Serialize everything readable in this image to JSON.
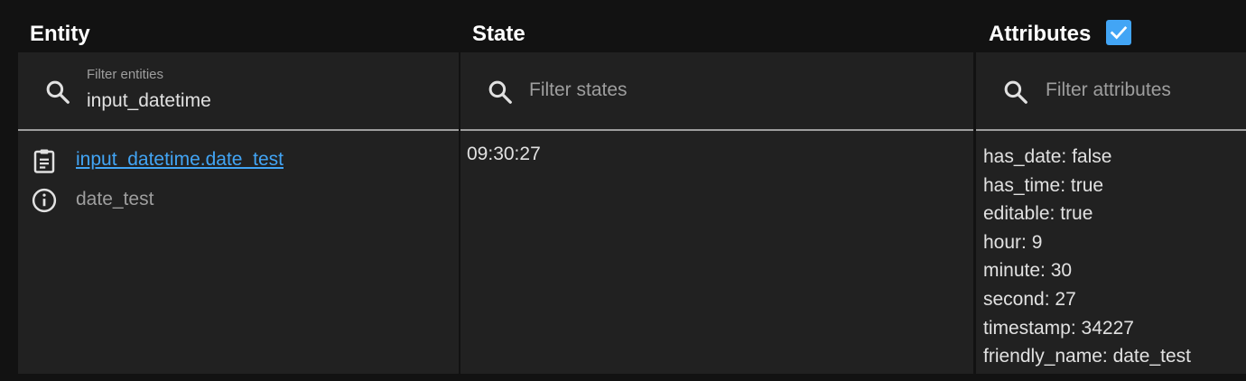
{
  "headers": {
    "entity": "Entity",
    "state": "State",
    "attributes": "Attributes"
  },
  "filters": {
    "entity": {
      "label": "Filter entities",
      "value": "input_datetime"
    },
    "state": {
      "placeholder": "Filter states"
    },
    "attributes": {
      "placeholder": "Filter attributes"
    }
  },
  "row": {
    "entity_id": "input_datetime.date_test",
    "entity_name": "date_test",
    "state": "09:30:27",
    "attributes": [
      "has_date: false",
      "has_time: true",
      "editable: true",
      "hour: 9",
      "minute: 30",
      "second: 27",
      "timestamp: 34227",
      "friendly_name: date_test"
    ]
  },
  "attributes_checkbox_checked": true,
  "colors": {
    "background": "#121212",
    "panel": "#212121",
    "accent": "#42a5f5",
    "text": "#e1e1e1",
    "muted": "#9e9e9e"
  },
  "icons": {
    "filter": "search-icon",
    "copy": "clipboard-text-icon",
    "info": "info-icon",
    "checkbox": "checkbox-checked-icon"
  }
}
